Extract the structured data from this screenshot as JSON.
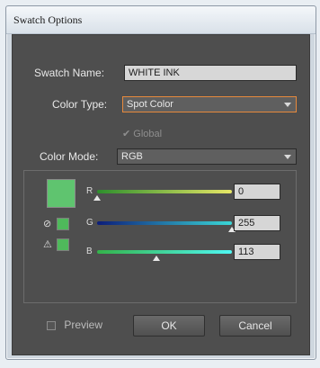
{
  "window": {
    "title": "Swatch Options"
  },
  "form": {
    "swatch_name_label": "Swatch Name:",
    "swatch_name_value": "White Ink",
    "color_type_label": "Color Type:",
    "color_type_value": "Spot Color",
    "global_label": "Global",
    "global_checked": true,
    "color_mode_label": "Color Mode:",
    "color_mode_value": "RGB"
  },
  "channels": [
    {
      "label": "R",
      "value": "0",
      "level": 0.0,
      "gradient_from": "#2d8e2d",
      "gradient_to": "#e7e766"
    },
    {
      "label": "G",
      "value": "255",
      "level": 1.0,
      "gradient_from": "#0c1d7a",
      "gradient_to": "#3ad6d6"
    },
    {
      "label": "B",
      "value": "113",
      "level": 0.443,
      "gradient_from": "#34b34a",
      "gradient_to": "#4ff7f2"
    }
  ],
  "swatch_color": "#5fc46f",
  "buttons": {
    "preview_label": "Preview",
    "ok_label": "OK",
    "cancel_label": "Cancel"
  },
  "icons": {
    "out_of_web_icon": "circle-slash",
    "out_of_gamut_icon": "warning-triangle"
  }
}
